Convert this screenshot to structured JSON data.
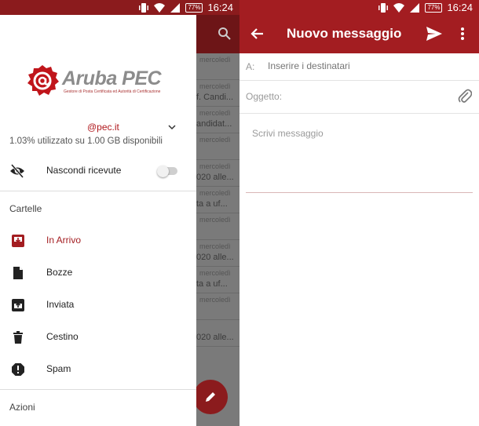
{
  "status_bar": {
    "time_left": "16:24",
    "time_right": "16:24",
    "battery": "77%"
  },
  "background_list": {
    "rows": [
      {
        "date": "mercoledì",
        "snippet": ""
      },
      {
        "date": "mercoledì",
        "snippet": "f. Candi..."
      },
      {
        "date": "mercoledì",
        "snippet": "andidat..."
      },
      {
        "date": "mercoledì",
        "snippet": ""
      },
      {
        "date": "mercoledì",
        "snippet": "020 alle..."
      },
      {
        "date": "mercoledì",
        "snippet": "ta a uf..."
      },
      {
        "date": "mercoledì",
        "snippet": ""
      },
      {
        "date": "mercoledì",
        "snippet": "020 alle..."
      },
      {
        "date": "mercoledì",
        "snippet": "ta a uf..."
      },
      {
        "date": "mercoledì",
        "snippet": ""
      },
      {
        "date": "",
        "snippet": "020 alle..."
      }
    ]
  },
  "drawer": {
    "logo": {
      "title": "Aruba PEC",
      "subtitle": "Gestore di Posta Certificata ed Autorità di Certificazione"
    },
    "account": {
      "email": "@pec.it",
      "usage": "1.03% utilizzato su 1.00 GB disponibili"
    },
    "toggle": {
      "label": "Nascondi ricevute",
      "on": false
    },
    "folders_heading": "Cartelle",
    "folders": [
      {
        "label": "In Arrivo",
        "icon": "inbox-icon",
        "active": true
      },
      {
        "label": "Bozze",
        "icon": "draft-icon",
        "active": false
      },
      {
        "label": "Inviata",
        "icon": "outbox-icon",
        "active": false
      },
      {
        "label": "Cestino",
        "icon": "trash-icon",
        "active": false
      },
      {
        "label": "Spam",
        "icon": "spam-icon",
        "active": false
      }
    ],
    "actions_heading": "Azioni"
  },
  "compose": {
    "title": "Nuovo messaggio",
    "to_label": "A:",
    "to_placeholder": "Inserire i destinatari",
    "subject_placeholder": "Oggetto:",
    "body_placeholder": "Scrivi messaggio"
  },
  "colors": {
    "brand_red": "#a31d21",
    "dark_red": "#8b1b1d"
  }
}
